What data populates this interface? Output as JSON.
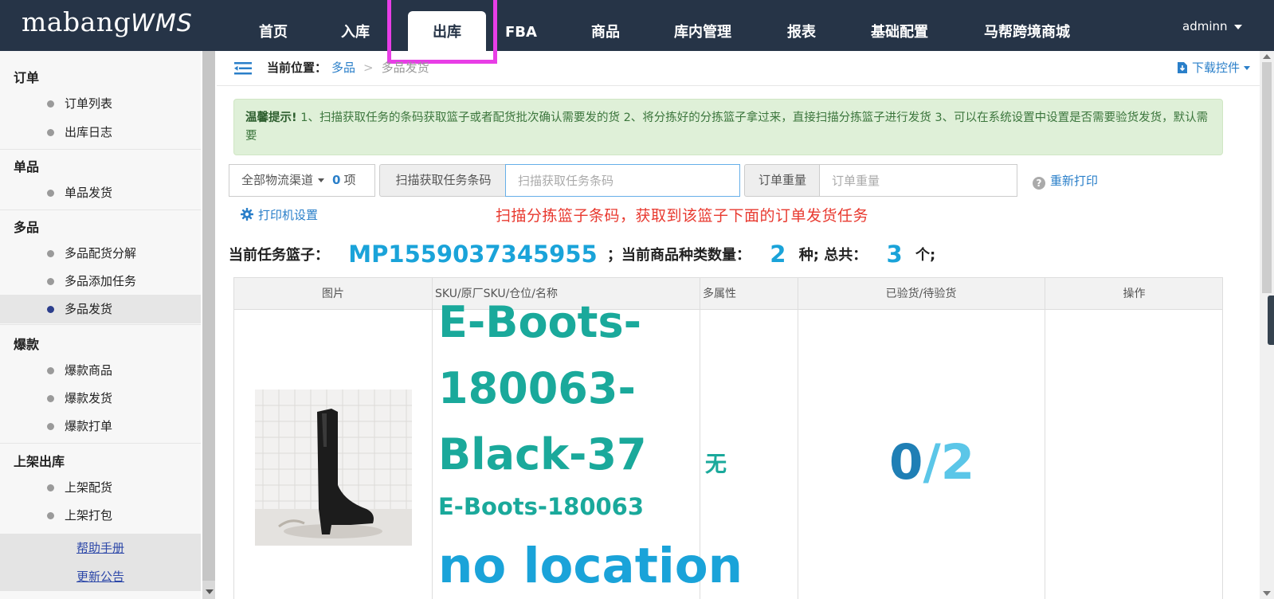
{
  "header": {
    "logo_text": "mabang",
    "logo_suffix": "WMS",
    "nav": [
      "首页",
      "入库",
      "出库",
      "FBA",
      "商品",
      "库内管理",
      "报表",
      "基础配置",
      "马帮跨境商城"
    ],
    "active_nav": "出库",
    "user": "adminn"
  },
  "sidebar": {
    "groups": [
      {
        "title": "订单",
        "items": [
          "订单列表",
          "出库日志"
        ]
      },
      {
        "title": "单品",
        "items": [
          "单品发货"
        ]
      },
      {
        "title": "多品",
        "items": [
          "多品配货分解",
          "多品添加任务",
          "多品发货"
        ]
      },
      {
        "title": "爆款",
        "items": [
          "爆款商品",
          "爆款发货",
          "爆款打单"
        ]
      },
      {
        "title": "上架出库",
        "items": [
          "上架配货",
          "上架打包"
        ]
      }
    ],
    "active_item": "多品发货",
    "links": [
      "帮助手册",
      "更新公告"
    ]
  },
  "breadcrumb": {
    "label": "当前位置：",
    "parent": "多品",
    "separator": ">",
    "current": "多品发货"
  },
  "download_label": "下载控件",
  "alert": {
    "title": "温馨提示!",
    "text": " 1、扫描获取任务的条码获取篮子或者配货批次确认需要发的货    2、将分拣好的分拣篮子拿过来，直接扫描分拣篮子进行发货    3、可以在系统设置中设置是否需要验货发货，默认需要"
  },
  "controls": {
    "channel_label": "全部物流渠道",
    "channel_count": "0",
    "channel_unit": "项",
    "scan_label": "扫描获取任务条码",
    "scan_placeholder": "扫描获取任务条码",
    "weight_label": "订单重量",
    "weight_placeholder": "订单重量",
    "reprint": "重新打印",
    "printer_settings": "打印机设置"
  },
  "hint": "扫描分拣篮子条码，获取到该篮子下面的订单发货任务",
  "task": {
    "basket_label": "当前任务篮子：",
    "basket_code": "MP1559037345955",
    "kind_label": "；当前商品种类数量：",
    "kind_count": "2",
    "kind_unit": "种; 总共：",
    "total": "3",
    "total_unit": "个;"
  },
  "table": {
    "headers": [
      "图片",
      "SKU/原厂SKU/仓位/名称",
      "多属性",
      "已验货/待验货",
      "操作"
    ],
    "row": {
      "sku": "E-Boots-180063-Black-37",
      "factory_sku": "E-Boots-180063",
      "location": "no location",
      "attribute": "无",
      "checked": "0",
      "pending": "/2"
    }
  },
  "colors": {
    "topbar": "#263447",
    "highlight": "#e83ee6",
    "accent": "#1aa3d9",
    "teal": "#1aa99b",
    "hint": "#e8392f"
  }
}
